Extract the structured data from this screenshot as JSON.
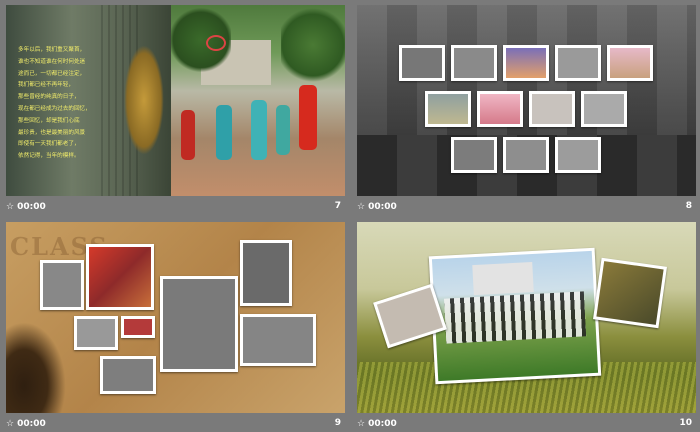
{
  "slides": [
    {
      "id": "7",
      "number": "7",
      "time": "00:00",
      "poem": [
        "多年以后，我们重又聚首，",
        "谁也不知道谁在何时何处迷",
        "途而已，一切都已经注定，",
        "我们都已经不再年轻，",
        "那些曾经的纯真的日子，",
        "现在都已经成为过去的回忆，",
        "那些回忆，却是我们心底",
        "最珍贵，也是最美丽的风景",
        "即使有一天我们都老了，",
        "依然记得，当年的模样。"
      ]
    },
    {
      "id": "8",
      "number": "8",
      "time": "00:00"
    },
    {
      "id": "9",
      "number": "9",
      "time": "00:00",
      "bg_text": "CLASS"
    },
    {
      "id": "10",
      "number": "10",
      "time": "00:00"
    }
  ],
  "icons": {
    "footer": "speaker-icon"
  }
}
